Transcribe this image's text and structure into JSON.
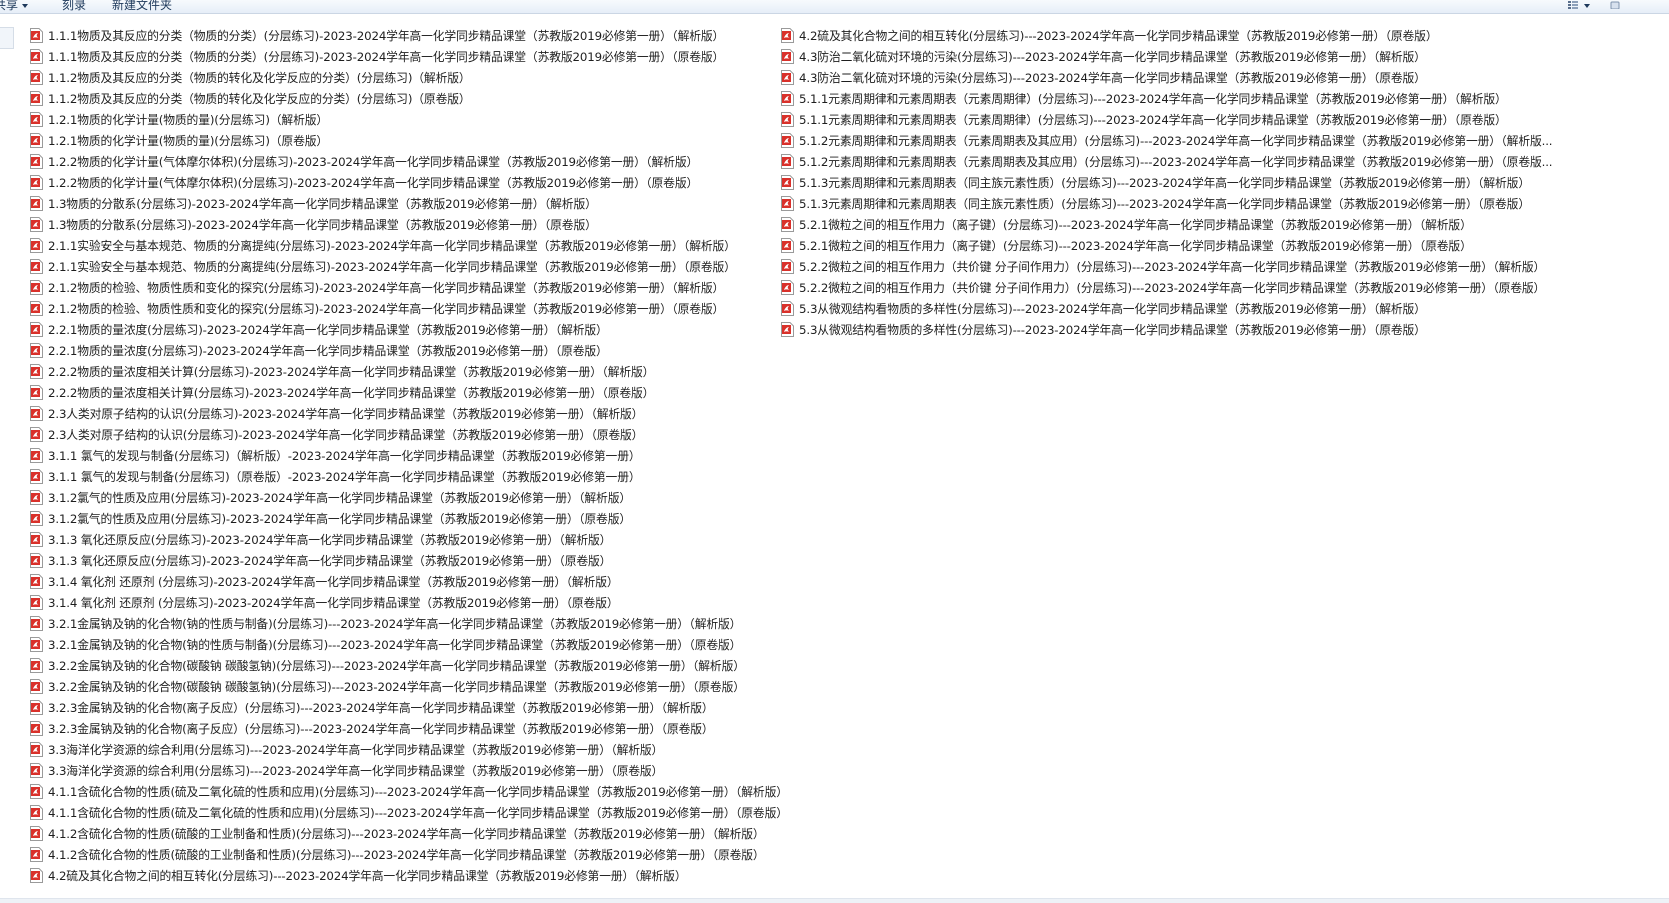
{
  "toolbar": {
    "share_label": "共享",
    "burn_label": "刻录",
    "new_folder_label": "新建文件夹"
  },
  "icons": {
    "file": "pdf-file-icon",
    "view": "view-options-icon",
    "help": "help-icon"
  },
  "colors": {
    "pdf_red": "#d9312b",
    "toolbar_text": "#1e395b"
  },
  "files_left": [
    "1.1.1物质及其反应的分类（物质的分类）(分层练习)-2023-2024学年高一化学同步精品课堂（苏教版2019必修第一册）（解析版）",
    "1.1.1物质及其反应的分类（物质的分类）(分层练习)-2023-2024学年高一化学同步精品课堂（苏教版2019必修第一册）（原卷版）",
    "1.1.2物质及其反应的分类（物质的转化及化学反应的分类）(分层练习)（解析版）",
    "1.1.2物质及其反应的分类（物质的转化及化学反应的分类）(分层练习)（原卷版）",
    "1.2.1物质的化学计量(物质的量)(分层练习)（解析版）",
    "1.2.1物质的化学计量(物质的量)(分层练习)（原卷版）",
    "1.2.2物质的化学计量(气体摩尔体积)(分层练习)-2023-2024学年高一化学同步精品课堂（苏教版2019必修第一册）（解析版）",
    "1.2.2物质的化学计量(气体摩尔体积)(分层练习)-2023-2024学年高一化学同步精品课堂（苏教版2019必修第一册）（原卷版）",
    "1.3物质的分散系(分层练习)-2023-2024学年高一化学同步精品课堂（苏教版2019必修第一册）（解析版）",
    "1.3物质的分散系(分层练习)-2023-2024学年高一化学同步精品课堂（苏教版2019必修第一册）（原卷版）",
    "2.1.1实验安全与基本规范、物质的分离提纯(分层练习)-2023-2024学年高一化学同步精品课堂（苏教版2019必修第一册）（解析版）",
    "2.1.1实验安全与基本规范、物质的分离提纯(分层练习)-2023-2024学年高一化学同步精品课堂（苏教版2019必修第一册）（原卷版）",
    "2.1.2物质的检验、物质性质和变化的探究(分层练习)-2023-2024学年高一化学同步精品课堂（苏教版2019必修第一册）（解析版）",
    "2.1.2物质的检验、物质性质和变化的探究(分层练习)-2023-2024学年高一化学同步精品课堂（苏教版2019必修第一册）（原卷版）",
    "2.2.1物质的量浓度(分层练习)-2023-2024学年高一化学同步精品课堂（苏教版2019必修第一册）（解析版）",
    "2.2.1物质的量浓度(分层练习)-2023-2024学年高一化学同步精品课堂（苏教版2019必修第一册）（原卷版）",
    "2.2.2物质的量浓度相关计算(分层练习)-2023-2024学年高一化学同步精品课堂（苏教版2019必修第一册）（解析版）",
    "2.2.2物质的量浓度相关计算(分层练习)-2023-2024学年高一化学同步精品课堂（苏教版2019必修第一册）（原卷版）",
    "2.3人类对原子结构的认识(分层练习)-2023-2024学年高一化学同步精品课堂（苏教版2019必修第一册）（解析版）",
    "2.3人类对原子结构的认识(分层练习)-2023-2024学年高一化学同步精品课堂（苏教版2019必修第一册）（原卷版）",
    "3.1.1 氯气的发现与制备(分层练习)（解析版）-2023-2024学年高一化学同步精品课堂（苏教版2019必修第一册）",
    "3.1.1 氯气的发现与制备(分层练习)（原卷版）-2023-2024学年高一化学同步精品课堂（苏教版2019必修第一册）",
    "3.1.2氯气的性质及应用(分层练习)-2023-2024学年高一化学同步精品课堂（苏教版2019必修第一册）（解析版）",
    "3.1.2氯气的性质及应用(分层练习)-2023-2024学年高一化学同步精品课堂（苏教版2019必修第一册）（原卷版）",
    "3.1.3 氧化还原反应(分层练习)-2023-2024学年高一化学同步精品课堂（苏教版2019必修第一册）（解析版）",
    "3.1.3 氧化还原反应(分层练习)-2023-2024学年高一化学同步精品课堂（苏教版2019必修第一册）（原卷版）",
    "3.1.4 氧化剂 还原剂 (分层练习)-2023-2024学年高一化学同步精品课堂（苏教版2019必修第一册）（解析版）",
    "3.1.4 氧化剂 还原剂 (分层练习)-2023-2024学年高一化学同步精品课堂（苏教版2019必修第一册）（原卷版）",
    "3.2.1金属钠及钠的化合物(钠的性质与制备)(分层练习)---2023-2024学年高一化学同步精品课堂（苏教版2019必修第一册）（解析版）",
    "3.2.1金属钠及钠的化合物(钠的性质与制备)(分层练习)---2023-2024学年高一化学同步精品课堂（苏教版2019必修第一册）（原卷版）",
    "3.2.2金属钠及钠的化合物(碳酸钠 碳酸氢钠)(分层练习)---2023-2024学年高一化学同步精品课堂（苏教版2019必修第一册）（解析版）",
    "3.2.2金属钠及钠的化合物(碳酸钠 碳酸氢钠)(分层练习)---2023-2024学年高一化学同步精品课堂（苏教版2019必修第一册）（原卷版）",
    "3.2.3金属钠及钠的化合物(离子反应）(分层练习)---2023-2024学年高一化学同步精品课堂（苏教版2019必修第一册）（解析版）",
    "3.2.3金属钠及钠的化合物(离子反应）(分层练习)---2023-2024学年高一化学同步精品课堂（苏教版2019必修第一册）（原卷版）",
    "3.3海洋化学资源的综合利用(分层练习)---2023-2024学年高一化学同步精品课堂（苏教版2019必修第一册）（解析版）",
    "3.3海洋化学资源的综合利用(分层练习)---2023-2024学年高一化学同步精品课堂（苏教版2019必修第一册）（原卷版）",
    "4.1.1含硫化合物的性质(硫及二氧化硫的性质和应用)(分层练习)---2023-2024学年高一化学同步精品课堂（苏教版2019必修第一册）（解析版）",
    "4.1.1含硫化合物的性质(硫及二氧化硫的性质和应用)(分层练习)---2023-2024学年高一化学同步精品课堂（苏教版2019必修第一册）（原卷版）",
    "4.1.2含硫化合物的性质(硫酸的工业制备和性质)(分层练习)---2023-2024学年高一化学同步精品课堂（苏教版2019必修第一册）（解析版）",
    "4.1.2含硫化合物的性质(硫酸的工业制备和性质)(分层练习)---2023-2024学年高一化学同步精品课堂（苏教版2019必修第一册）（原卷版）",
    "4.2硫及其化合物之间的相互转化(分层练习)---2023-2024学年高一化学同步精品课堂（苏教版2019必修第一册）（解析版）"
  ],
  "files_right": [
    "4.2硫及其化合物之间的相互转化(分层练习)---2023-2024学年高一化学同步精品课堂（苏教版2019必修第一册）（原卷版）",
    "4.3防治二氧化硫对环境的污染(分层练习)---2023-2024学年高一化学同步精品课堂（苏教版2019必修第一册）（解析版）",
    "4.3防治二氧化硫对环境的污染(分层练习)---2023-2024学年高一化学同步精品课堂（苏教版2019必修第一册）（原卷版）",
    "5.1.1元素周期律和元素周期表（元素周期律）(分层练习)---2023-2024学年高一化学同步精品课堂（苏教版2019必修第一册）（解析版）",
    "5.1.1元素周期律和元素周期表（元素周期律）(分层练习)---2023-2024学年高一化学同步精品课堂（苏教版2019必修第一册）（原卷版）",
    "5.1.2元素周期律和元素周期表（元素周期表及其应用）(分层练习)---2023-2024学年高一化学同步精品课堂（苏教版2019必修第一册）（解析版...",
    "5.1.2元素周期律和元素周期表（元素周期表及其应用）(分层练习)---2023-2024学年高一化学同步精品课堂（苏教版2019必修第一册）（原卷版...",
    "5.1.3元素周期律和元素周期表（同主族元素性质）(分层练习)---2023-2024学年高一化学同步精品课堂（苏教版2019必修第一册）（解析版）",
    "5.1.3元素周期律和元素周期表（同主族元素性质）(分层练习)---2023-2024学年高一化学同步精品课堂（苏教版2019必修第一册）（原卷版）",
    "5.2.1微粒之间的相互作用力（离子键）(分层练习)---2023-2024学年高一化学同步精品课堂（苏教版2019必修第一册）（解析版）",
    "5.2.1微粒之间的相互作用力（离子键）(分层练习)---2023-2024学年高一化学同步精品课堂（苏教版2019必修第一册）（原卷版）",
    "5.2.2微粒之间的相互作用力（共价键 分子间作用力）(分层练习)---2023-2024学年高一化学同步精品课堂（苏教版2019必修第一册）（解析版）",
    "5.2.2微粒之间的相互作用力（共价键 分子间作用力）(分层练习)---2023-2024学年高一化学同步精品课堂（苏教版2019必修第一册）（原卷版）",
    "5.3从微观结构看物质的多样性(分层练习)---2023-2024学年高一化学同步精品课堂（苏教版2019必修第一册）（解析版）",
    "5.3从微观结构看物质的多样性(分层练习)---2023-2024学年高一化学同步精品课堂（苏教版2019必修第一册）（原卷版）"
  ]
}
